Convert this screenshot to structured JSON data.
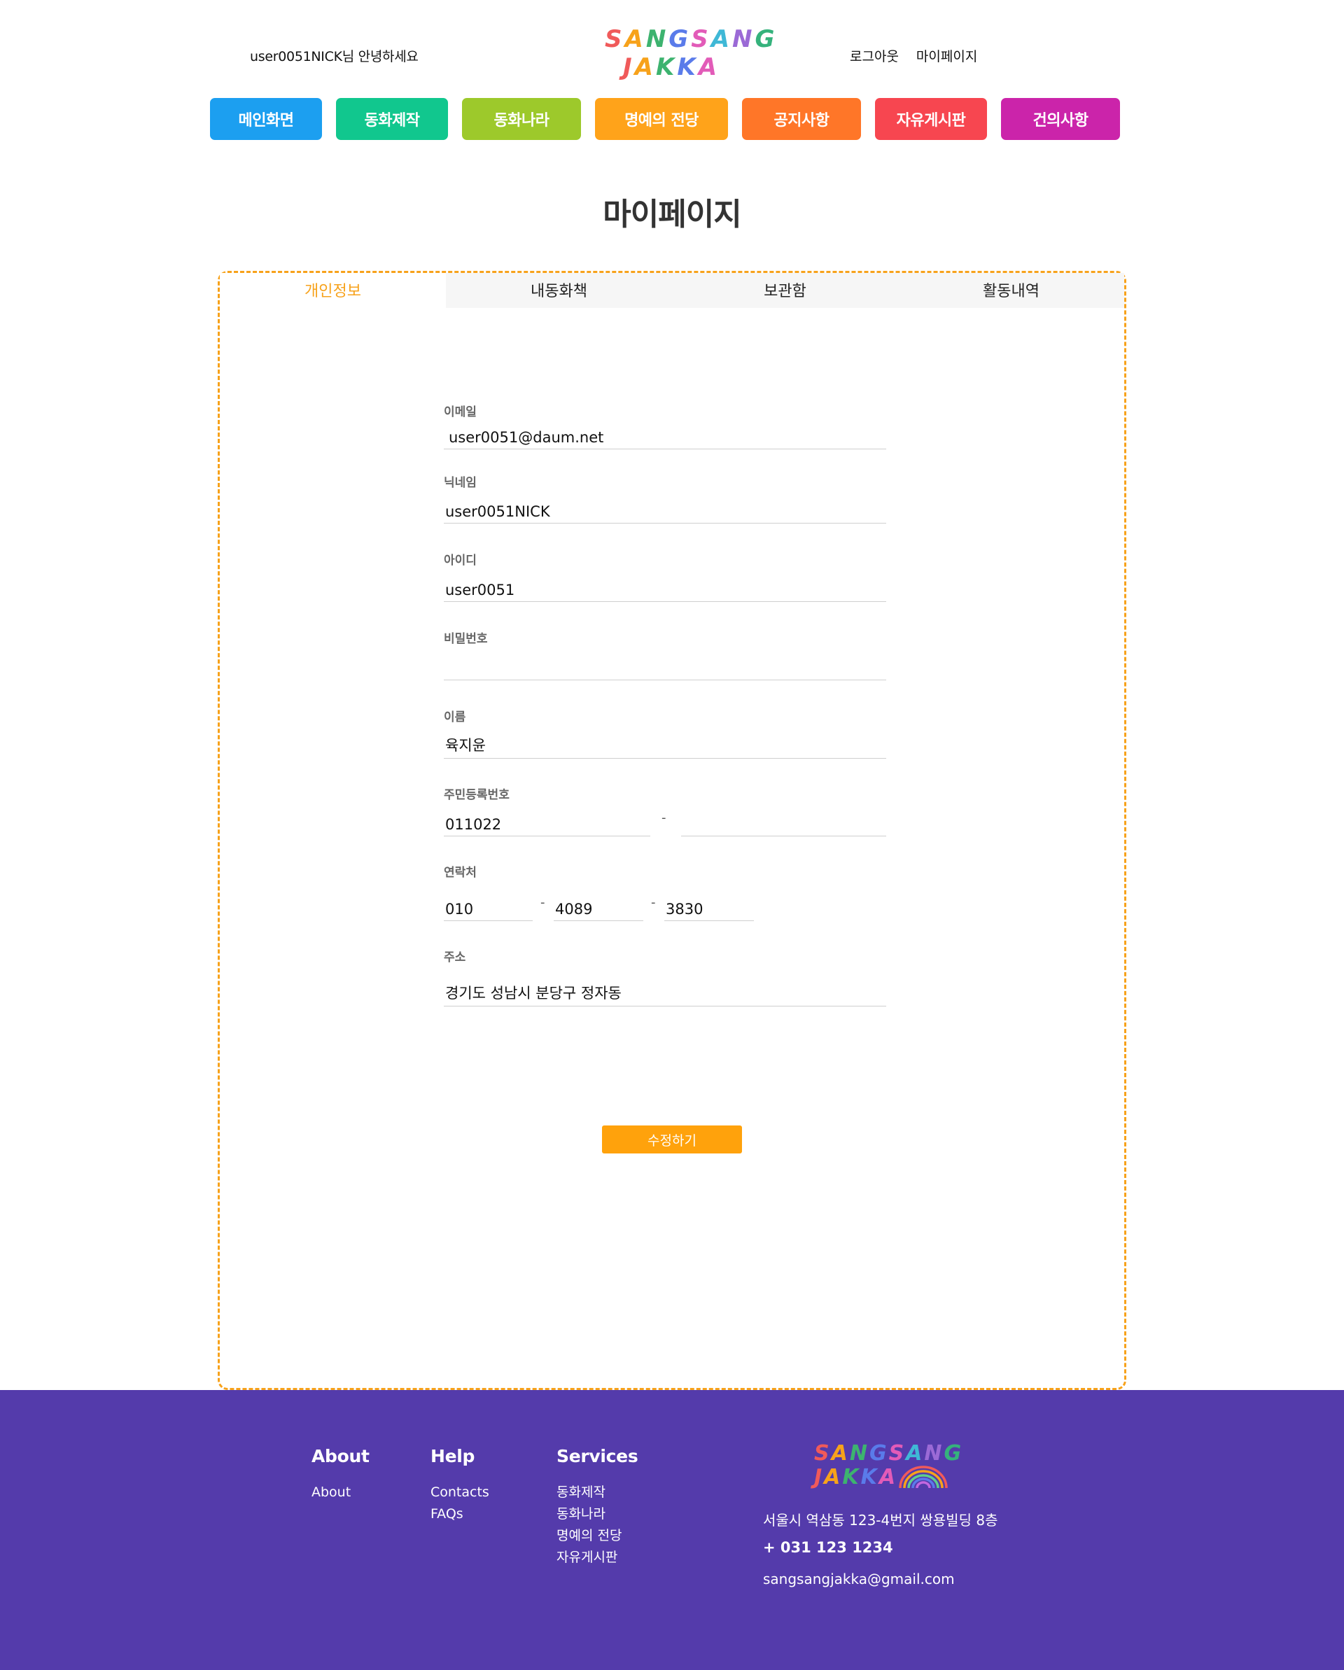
{
  "header": {
    "greeting": "user0051NICK님 안녕하세요",
    "logo_line1": "SANGSANG",
    "logo_line2": "JAKKA",
    "logout": "로그아웃",
    "mypage": "마이페이지"
  },
  "nav": [
    {
      "label": "메인화면",
      "color": "#1c9ff0"
    },
    {
      "label": "동화제작",
      "color": "#11c78e"
    },
    {
      "label": "동화나라",
      "color": "#9dc92b"
    },
    {
      "label": "명예의 전당",
      "color": "#ffa31a"
    },
    {
      "label": "공지사항",
      "color": "#ff7628"
    },
    {
      "label": "자유게시판",
      "color": "#f74650"
    },
    {
      "label": "건의사항",
      "color": "#cb24aa"
    }
  ],
  "page_title": "마이페이지",
  "tabs": [
    "개인정보",
    "내동화책",
    "보관함",
    "활동내역"
  ],
  "active_tab": "개인정보",
  "form": {
    "email_label": "이메일",
    "email_value": "user0051@daum.net",
    "nickname_label": "닉네임",
    "nickname_value": "user0051NICK",
    "id_label": "아이디",
    "id_value": "user0051",
    "password_label": "비밀번호",
    "password_value": "",
    "name_label": "이름",
    "name_value": "육지윤",
    "rrn_label": "주민등록번호",
    "rrn_front": "011022",
    "rrn_back": "",
    "phone_label": "연락처",
    "phone_1": "010",
    "phone_2": "4089",
    "phone_3": "3830",
    "address_label": "주소",
    "address_value": "경기도 성남시 분당구 정자동",
    "separator": "-",
    "submit": "수정하기"
  },
  "footer": {
    "about": {
      "heading": "About",
      "items": [
        "About"
      ]
    },
    "help": {
      "heading": "Help",
      "items": [
        "Contacts",
        "FAQs"
      ]
    },
    "services": {
      "heading": "Services",
      "items": [
        "동화제작",
        "동화나라",
        "명예의 전당",
        "자유게시판"
      ]
    },
    "logo_line1": "SANGSANG",
    "logo_line2": "JAKKA",
    "address": "서울시 역삼동 123-4번지 쌍용빌딩 8층",
    "phone": "+ 031 123 1234",
    "email": "sangsangjakka@gmail.com"
  },
  "colors": {
    "accent": "#f7a21b",
    "footer_bg": "#543bab",
    "logo_letters": [
      "#f05a5a",
      "#f7a21b",
      "#3db36f",
      "#5a7bea",
      "#e25bb8",
      "#3fb8d6",
      "#9b6ad6",
      "#35b27c"
    ]
  }
}
